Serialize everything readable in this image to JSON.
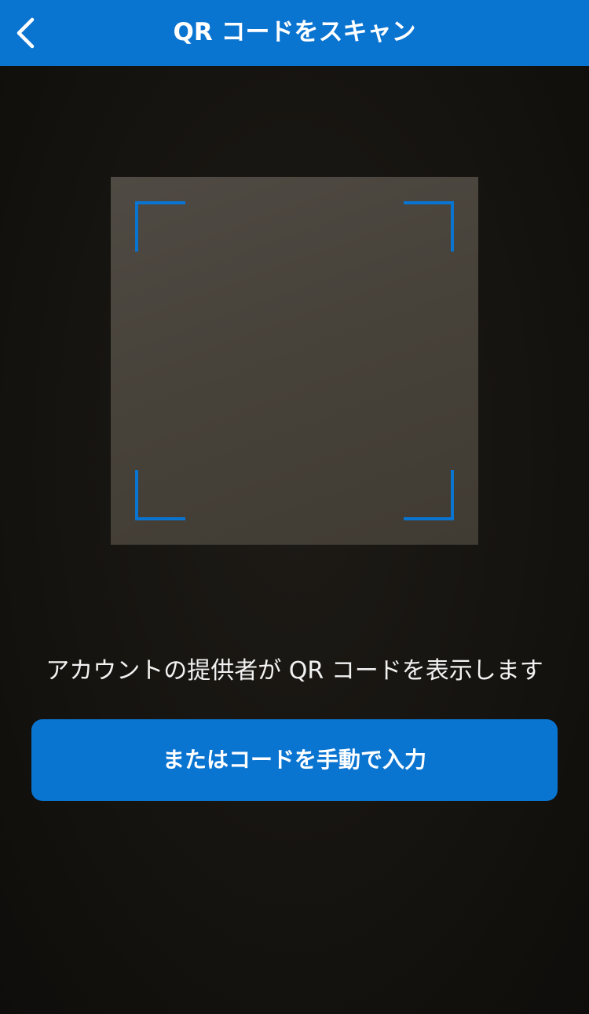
{
  "nav": {
    "title": "QR コードをスキャン",
    "back_icon": "chevron-left-icon"
  },
  "scanner": {
    "frame_color": "#0a74d1"
  },
  "instruction_text": "アカウントの提供者が QR コードを表示します",
  "manual_button": {
    "label": "またはコードを手動で入力"
  },
  "colors": {
    "accent": "#0a74d1",
    "background": "#13110e",
    "text": "#f2f2f2"
  }
}
